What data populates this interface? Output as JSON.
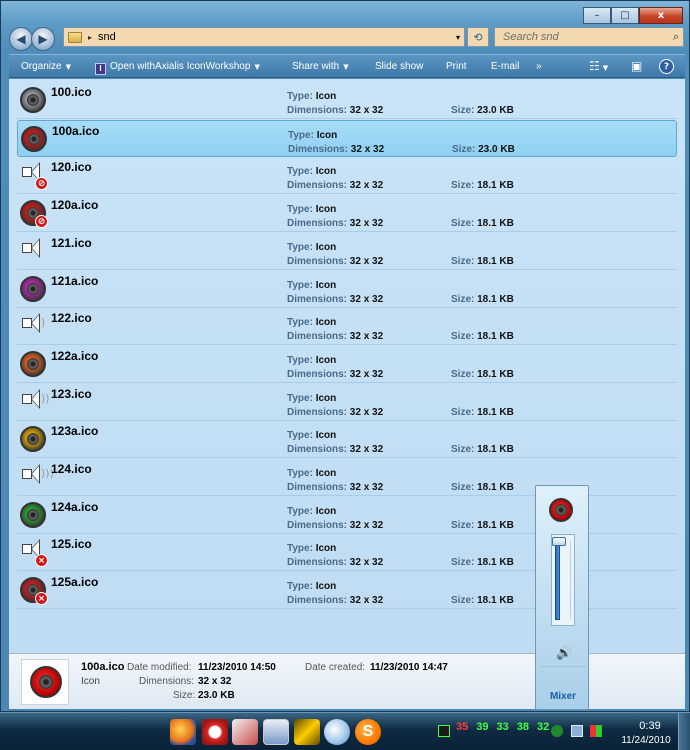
{
  "window": {
    "caption_buttons": {
      "minimize": "–",
      "maximize": "□",
      "close": "x"
    }
  },
  "address": {
    "separator": "▸",
    "path": "snd",
    "dropdown": "▾",
    "refresh": "⟲"
  },
  "search": {
    "placeholder": "Search snd",
    "icon": "⌕"
  },
  "toolbar": {
    "organize": "Organize",
    "open_with": "Open withAxialis IconWorkshop",
    "share_with": "Share with",
    "slide_show": "Slide show",
    "print": "Print",
    "email": "E-mail",
    "more": "»",
    "help": "?"
  },
  "labels": {
    "type": "Type:",
    "dimensions": "Dimensions:",
    "size": "Size:"
  },
  "files": [
    {
      "name": "100.ico",
      "type": "Icon",
      "dimensions": "32 x 32",
      "size": "23.0 KB",
      "icon": "grey-speaker-icon",
      "selected": false
    },
    {
      "name": "100a.ico",
      "type": "Icon",
      "dimensions": "32 x 32",
      "size": "23.0 KB",
      "icon": "red-speaker-icon",
      "selected": true
    },
    {
      "name": "120.ico",
      "type": "Icon",
      "dimensions": "32 x 32",
      "size": "18.1 KB",
      "icon": "speaker-muted-icon",
      "selected": false
    },
    {
      "name": "120a.ico",
      "type": "Icon",
      "dimensions": "32 x 32",
      "size": "18.1 KB",
      "icon": "red-speaker-muted-icon",
      "selected": false
    },
    {
      "name": "121.ico",
      "type": "Icon",
      "dimensions": "32 x 32",
      "size": "18.1 KB",
      "icon": "speaker-icon",
      "selected": false
    },
    {
      "name": "121a.ico",
      "type": "Icon",
      "dimensions": "32 x 32",
      "size": "18.1 KB",
      "icon": "purple-speaker-icon",
      "selected": false
    },
    {
      "name": "122.ico",
      "type": "Icon",
      "dimensions": "32 x 32",
      "size": "18.1 KB",
      "icon": "speaker-low-icon",
      "selected": false
    },
    {
      "name": "122a.ico",
      "type": "Icon",
      "dimensions": "32 x 32",
      "size": "18.1 KB",
      "icon": "orange-speaker-icon",
      "selected": false
    },
    {
      "name": "123.ico",
      "type": "Icon",
      "dimensions": "32 x 32",
      "size": "18.1 KB",
      "icon": "speaker-medium-icon",
      "selected": false
    },
    {
      "name": "123a.ico",
      "type": "Icon",
      "dimensions": "32 x 32",
      "size": "18.1 KB",
      "icon": "yellow-speaker-icon",
      "selected": false
    },
    {
      "name": "124.ico",
      "type": "Icon",
      "dimensions": "32 x 32",
      "size": "18.1 KB",
      "icon": "speaker-high-icon",
      "selected": false
    },
    {
      "name": "124a.ico",
      "type": "Icon",
      "dimensions": "32 x 32",
      "size": "18.1 KB",
      "icon": "green-speaker-icon",
      "selected": false
    },
    {
      "name": "125.ico",
      "type": "Icon",
      "dimensions": "32 x 32",
      "size": "18.1 KB",
      "icon": "speaker-error-icon",
      "selected": false
    },
    {
      "name": "125a.ico",
      "type": "Icon",
      "dimensions": "32 x 32",
      "size": "18.1 KB",
      "icon": "red-speaker-error-icon",
      "selected": false
    }
  ],
  "details": {
    "name": "100a.ico",
    "kind": "Icon",
    "date_modified_label": "Date modified:",
    "date_modified": "11/23/2010 14:50",
    "date_created_label": "Date created:",
    "date_created": "11/23/2010 14:47",
    "dimensions_label": "Dimensions:",
    "dimensions": "32 x 32",
    "size_label": "Size:",
    "size": "23.0 KB"
  },
  "mixer": {
    "link": "Mixer",
    "volume_level": 0.95,
    "mute_icon": "🔊"
  },
  "taskbar": {
    "tray_numbers": [
      "35",
      "39",
      "33",
      "38",
      "32"
    ],
    "clock_time": "0:39",
    "clock_date": "11/24/2010"
  },
  "colors": {
    "selected_row": "#99d5f3",
    "list_background": "#c6e1f5",
    "mixer_fill": "#2a6fc0"
  }
}
